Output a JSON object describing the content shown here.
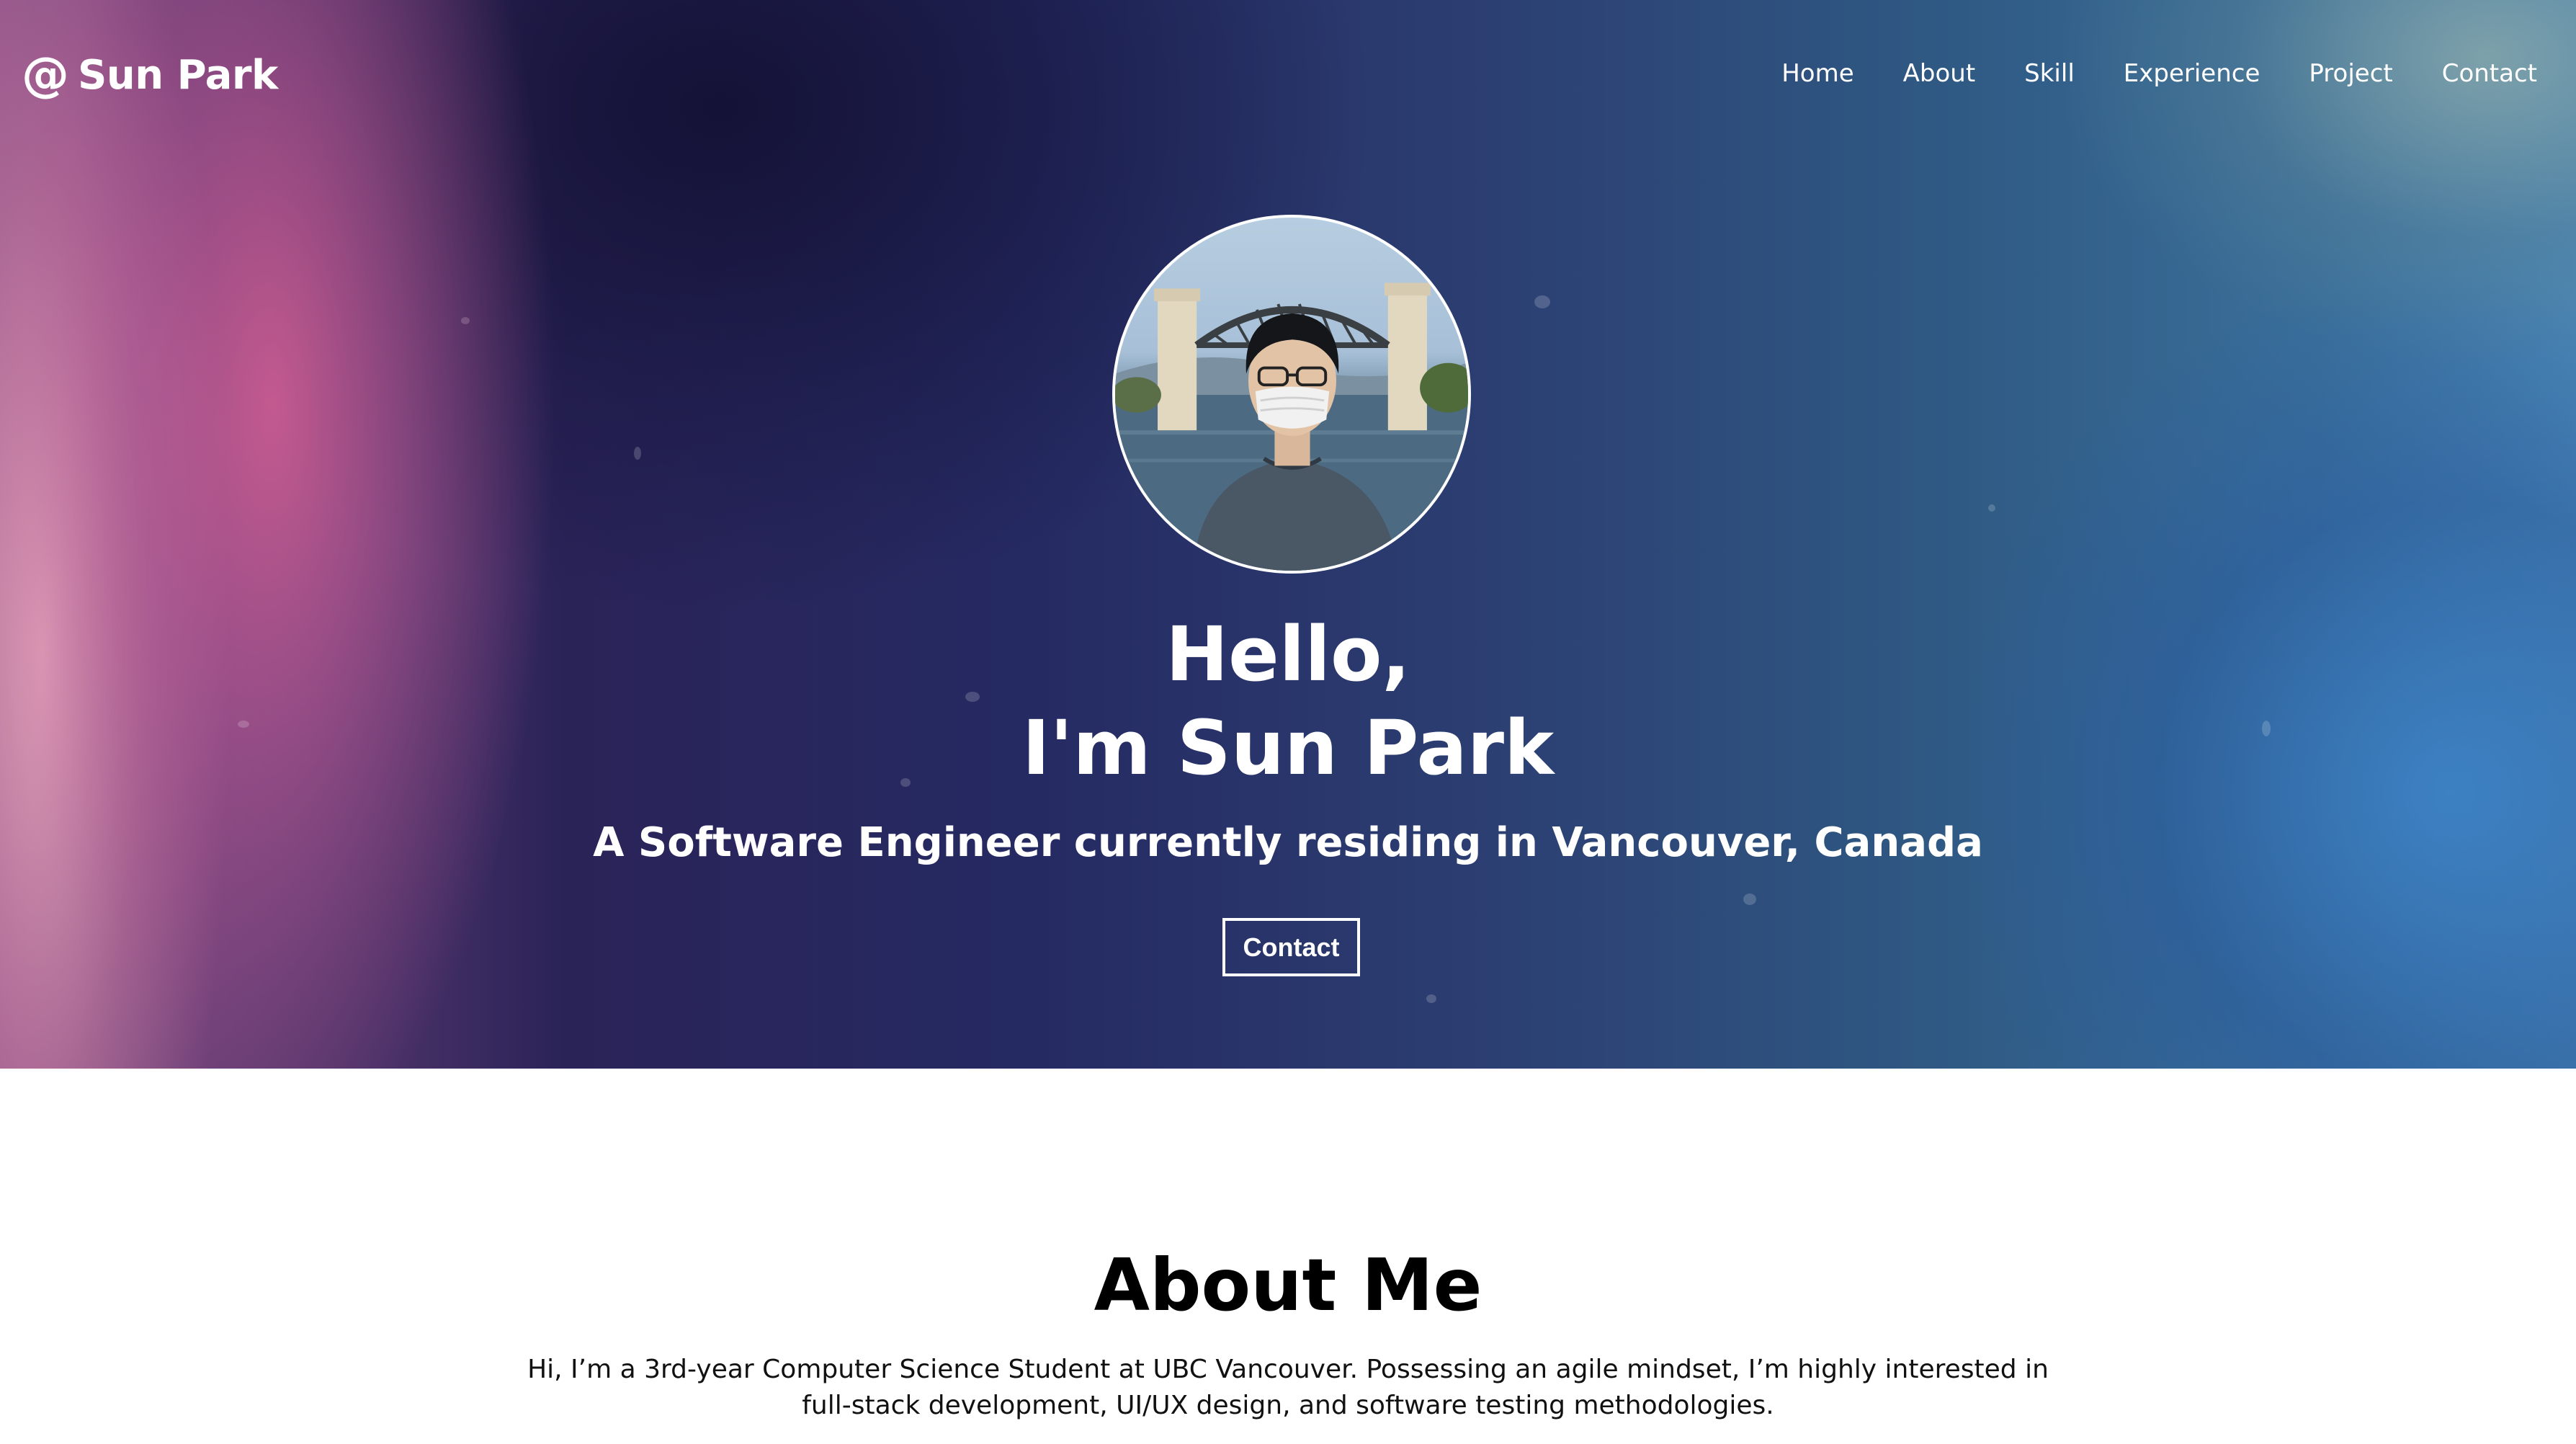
{
  "brand": {
    "icon": "at-sign-icon",
    "icon_glyph": "@",
    "name": "Sun Park"
  },
  "nav": {
    "items": [
      {
        "label": "Home"
      },
      {
        "label": "About"
      },
      {
        "label": "Skill"
      },
      {
        "label": "Experience"
      },
      {
        "label": "Project"
      },
      {
        "label": "Contact"
      }
    ]
  },
  "hero": {
    "greeting_line1": "Hello,",
    "greeting_line2": "I'm Sun Park",
    "subtitle": "A Software Engineer currently residing in Vancouver, Canada",
    "contact_button": "Contact",
    "avatar_alt": "Profile photo"
  },
  "about": {
    "title": "About Me",
    "body": "Hi, I’m a 3rd-year Computer Science Student at UBC Vancouver. Possessing an agile mindset, I’m highly interested in full-stack development, UI/UX design, and software testing methodologies."
  },
  "colors": {
    "hero_pink": "#d6609a",
    "hero_navy": "#252a62",
    "hero_blue": "#3a6f9a",
    "text_white": "#ffffff",
    "text_black": "#000000"
  }
}
